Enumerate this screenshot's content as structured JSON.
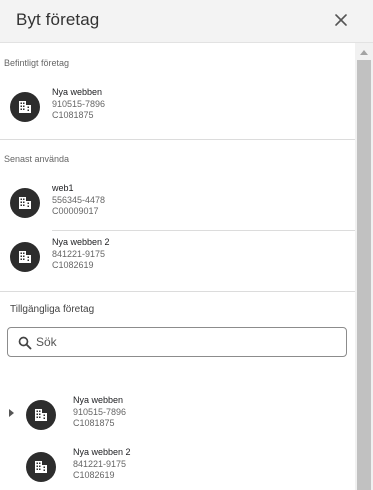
{
  "header": {
    "title": "Byt företag",
    "close_icon": "close-icon"
  },
  "current_section": {
    "label": "Befintligt företag",
    "company": {
      "name": "Nya webben",
      "org_number": "910515-7896",
      "code": "C1081875",
      "icon": "building-icon"
    }
  },
  "recent_section": {
    "label": "Senast använda",
    "items": [
      {
        "name": "web1",
        "org_number": "556345-4478",
        "code": "C00009017",
        "icon": "building-icon"
      },
      {
        "name": "Nya webben 2",
        "org_number": "841221-9175",
        "code": "C1082619",
        "icon": "building-icon"
      }
    ]
  },
  "available_section": {
    "label": "Tillgängliga företag",
    "search": {
      "placeholder": "Sök",
      "value": "",
      "icon": "search-icon"
    },
    "items": [
      {
        "name": "Nya webben",
        "org_number": "910515-7896",
        "code": "C1081875",
        "icon": "building-icon",
        "expandable": true
      },
      {
        "name": "Nya webben 2",
        "org_number": "841221-9175",
        "code": "C1082619",
        "icon": "building-icon",
        "expandable": false
      }
    ]
  },
  "colors": {
    "header_bg": "#f3f3f3",
    "icon_bg": "#2d2d2d",
    "divider": "#dcdcdc",
    "secondary_text": "#666666"
  }
}
